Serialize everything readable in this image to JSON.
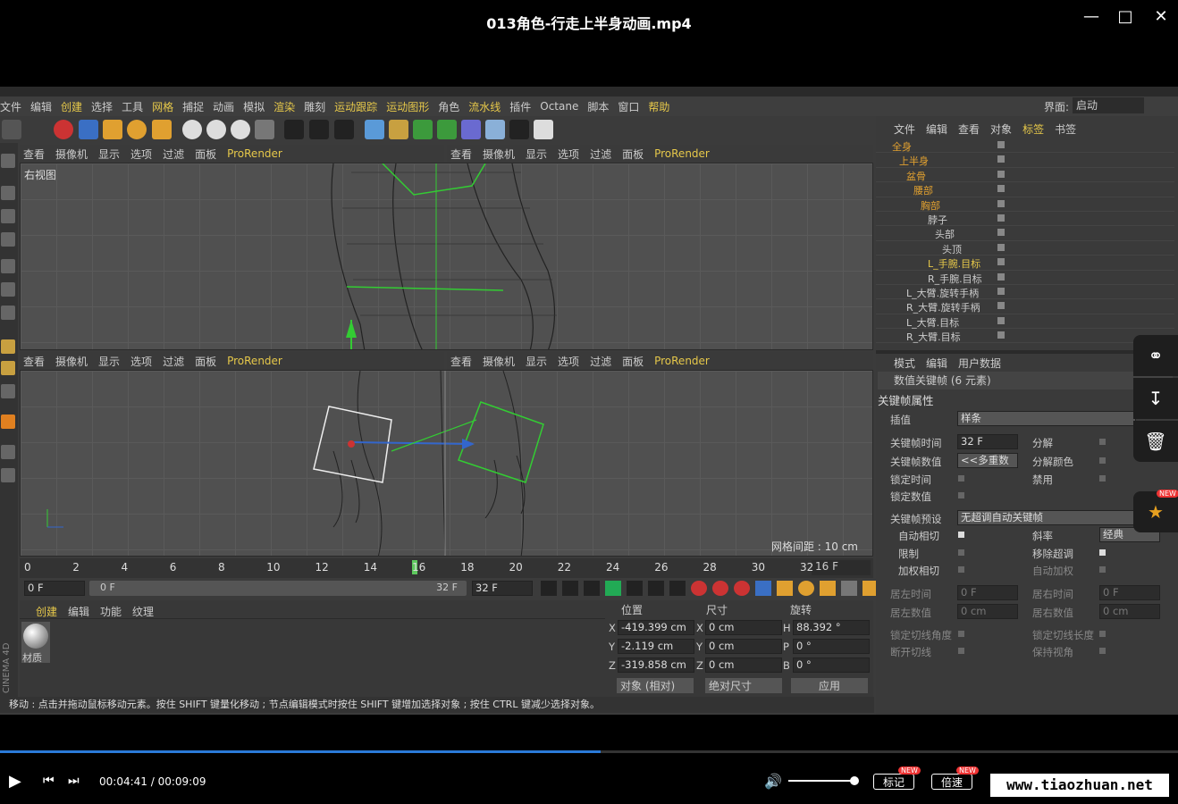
{
  "window": {
    "title": "013角色-行走上半身动画.mp4",
    "min_label": "—",
    "max_label": "□",
    "close_label": "✕"
  },
  "menu": [
    "文件",
    "编辑",
    "创建",
    "选择",
    "工具",
    "网格",
    "捕捉",
    "动画",
    "模拟",
    "渲染",
    "雕刻",
    "运动跟踪",
    "运动图形",
    "角色",
    "流水线",
    "插件",
    "Octane",
    "脚本",
    "窗口",
    "帮助"
  ],
  "menu_highlight": [
    "创建",
    "网格",
    "渲染",
    "运动跟踪",
    "运动图形",
    "流水线",
    "帮助"
  ],
  "layout": {
    "label": "界面:",
    "value": "启动"
  },
  "viewport_menu": [
    "查看",
    "摄像机",
    "显示",
    "选项",
    "过滤",
    "面板",
    "ProRender"
  ],
  "viewports": {
    "top_left_name": "右视图",
    "grid_spacing": "网格间距 : 10 cm"
  },
  "object_tabs": [
    "文件",
    "编辑",
    "查看",
    "对象",
    "标签",
    "书签"
  ],
  "objects": [
    {
      "name": "全身",
      "indent": 0,
      "color": "#e0a030"
    },
    {
      "name": "上半身",
      "indent": 1,
      "color": "#e0a030"
    },
    {
      "name": "盆骨",
      "indent": 2,
      "color": "#e0a030"
    },
    {
      "name": "腰部",
      "indent": 3,
      "color": "#e0a030"
    },
    {
      "name": "胸部",
      "indent": 4,
      "color": "#e0a030"
    },
    {
      "name": "脖子",
      "indent": 5,
      "color": "#ccc"
    },
    {
      "name": "头部",
      "indent": 6,
      "color": "#ccc"
    },
    {
      "name": "头顶",
      "indent": 7,
      "color": "#ccc"
    },
    {
      "name": "L_手腕.目标",
      "indent": 5,
      "color": "#e6c84a"
    },
    {
      "name": "R_手腕.目标",
      "indent": 5,
      "color": "#ccc"
    },
    {
      "name": "L_大臂.旋转手柄",
      "indent": 2,
      "color": "#ccc"
    },
    {
      "name": "R_大臂.旋转手柄",
      "indent": 2,
      "color": "#ccc"
    },
    {
      "name": "L_大臂.目标",
      "indent": 2,
      "color": "#ccc"
    },
    {
      "name": "R_大臂.目标",
      "indent": 2,
      "color": "#ccc"
    }
  ],
  "attr_tabs": [
    "模式",
    "编辑",
    "用户数据"
  ],
  "attr": {
    "header": "数值关键帧 (6 元素)",
    "section": "关键帧属性",
    "interp_label": "插值",
    "interp_value": "样条",
    "key_time_label": "关键帧时间",
    "key_time_value": "32 F",
    "key_value_label": "关键帧数值",
    "key_value_value": "<<多重数",
    "lock_time": "锁定时间",
    "lock_value": "锁定数值",
    "split": "分解",
    "split_color": "分解颜色",
    "mute": "禁用",
    "preset_label": "关键帧预设",
    "preset_value": "无超调自动关键帧",
    "auto_tangent": "自动相切",
    "slope": "斜率",
    "slope_value": "经典",
    "clamp": "限制",
    "remove_overshoot": "移除超调",
    "weighted": "加权相切",
    "auto_weight": "自动加权",
    "left_time": "居左时间",
    "left_time_value": "0 F",
    "right_time": "居右时间",
    "right_time_value": "0 F",
    "left_value": "居左数值",
    "left_value_value": "0 cm",
    "right_value": "居右数值",
    "right_value_value": "0 cm",
    "lock_tangent_angle": "锁定切线角度",
    "lock_tangent_length": "锁定切线长度",
    "break_tangent": "断开切线",
    "keep_visual": "保持视角"
  },
  "timeline": {
    "ticks": [
      "0",
      "2",
      "4",
      "6",
      "8",
      "10",
      "12",
      "14",
      "16",
      "18",
      "20",
      "22",
      "24",
      "26",
      "28",
      "30",
      "32"
    ],
    "current": "16 F",
    "start": "0 F",
    "range_start": "0 F",
    "range_end": "32 F",
    "end": "32 F",
    "current_frame": 16,
    "max_frame": 32
  },
  "material": {
    "tabs": [
      "创建",
      "编辑",
      "功能",
      "纹理"
    ],
    "name": "材质"
  },
  "coords": {
    "headers": [
      "位置",
      "尺寸",
      "旋转"
    ],
    "rows": [
      {
        "a": "X",
        "pos": "-419.399 cm",
        "b": "X",
        "size": "0 cm",
        "c": "H",
        "rot": "88.392 °"
      },
      {
        "a": "Y",
        "pos": "-2.119 cm",
        "b": "Y",
        "size": "0 cm",
        "c": "P",
        "rot": "0 °"
      },
      {
        "a": "Z",
        "pos": "-319.858 cm",
        "b": "Z",
        "size": "0 cm",
        "c": "B",
        "rot": "0 °"
      }
    ],
    "mode": "对象 (相对)",
    "size_mode": "绝对尺寸",
    "apply": "应用"
  },
  "status": "移动 : 点击并拖动鼠标移动元素。按住 SHIFT 键量化移动 ; 节点编辑模式时按住 SHIFT 键增加选择对象 ; 按住 CTRL 键减少选择对象。",
  "player": {
    "time": "00:04:41 / 00:09:09",
    "progress": 0.51,
    "mark": "标记",
    "speed": "倍速",
    "new_badge": "NEW",
    "watermark": "www.tiaozhuan.net",
    "volume": 0.95
  },
  "brand": "CINEMA 4D"
}
